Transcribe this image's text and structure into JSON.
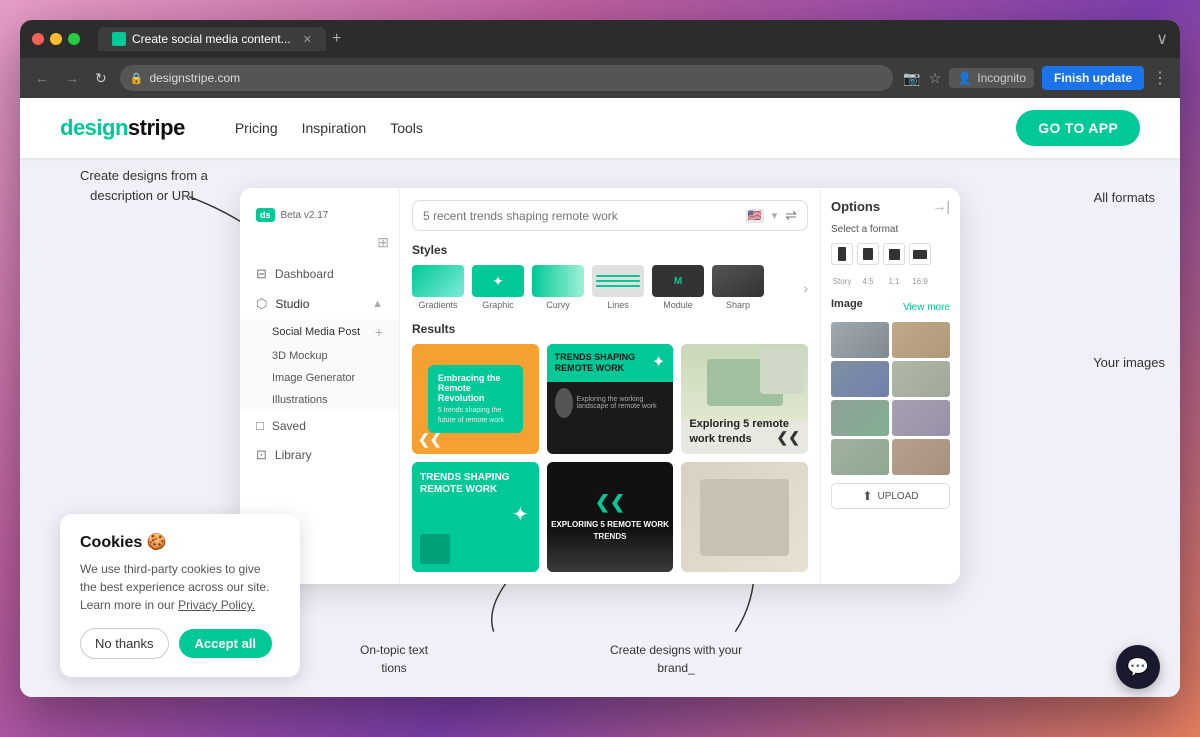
{
  "browser": {
    "tab_title": "Create social media content...",
    "url": "designstripe.com",
    "incognito_label": "Incognito",
    "finish_update_label": "Finish update"
  },
  "navbar": {
    "logo_text": "designstripe",
    "nav_links": [
      "Pricing",
      "Inspiration",
      "Tools"
    ],
    "cta_label": "GO TO APP"
  },
  "app": {
    "beta_label": "Beta v2.17",
    "search_placeholder": "5 recent trends shaping remote work",
    "styles_label": "Styles",
    "styles": [
      {
        "label": "Gradients"
      },
      {
        "label": "Graphic"
      },
      {
        "label": "Curvy"
      },
      {
        "label": "Lines"
      },
      {
        "label": "Module"
      },
      {
        "label": "Sharp"
      }
    ],
    "results_label": "Results",
    "sidebar": {
      "dashboard_label": "Dashboard",
      "studio_label": "Studio",
      "social_media_post_label": "Social Media Post",
      "mockup_label": "3D Mockup",
      "image_gen_label": "Image Generator",
      "illustrations_label": "Illustrations",
      "saved_label": "Saved",
      "library_label": "Library"
    },
    "options": {
      "title": "Options",
      "format_label": "Select a format",
      "format_options": [
        "Story",
        "4:5",
        "1:1",
        "16:9"
      ],
      "image_label": "Image",
      "view_more_label": "View more",
      "upload_label": "UPLOAD"
    },
    "cards": [
      {
        "title": "Embracing the Remote Revolution",
        "subtitle": "5 trends shaping the future of remote work"
      },
      {
        "title": "TRENDS SHAPING REMOTE WORK"
      },
      {
        "title": "Exploring 5 remote work trends"
      },
      {
        "title": "TRENDS SHAPING REMOTE WORK"
      },
      {
        "title": "EXPLORING 5 REMOTE WORK TRENDS"
      },
      {
        "title": ""
      }
    ]
  },
  "cookie_banner": {
    "title": "Cookies 🍪",
    "text": "We use third-party cookies to give the best experience across our site. Learn more in our Privacy Policy.",
    "no_thanks_label": "No thanks",
    "accept_label": "Accept all"
  },
  "annotations": {
    "top_left": "Create designs from a\ndescription or URL",
    "top_right": "All formats",
    "bottom_left": "On-topic text\ntions",
    "bottom_right": "Create designs with your\nbrand_",
    "right": "Your images"
  }
}
